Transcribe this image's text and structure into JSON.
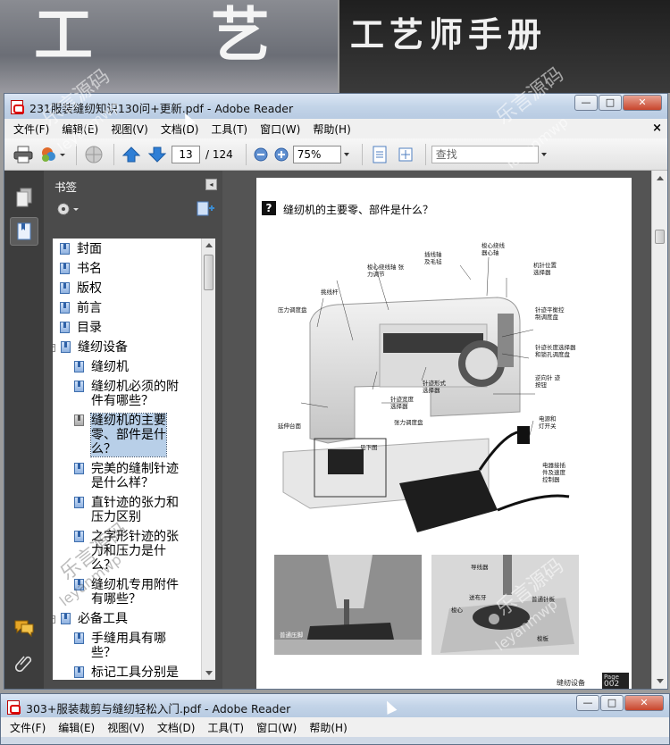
{
  "background": {
    "left_cover_chars": [
      "工",
      "艺"
    ],
    "right_cover_title": "工艺师手册"
  },
  "window1": {
    "title": "231服装缝纫知识130问+更新.pdf - Adobe Reader",
    "menus": [
      "文件(F)",
      "编辑(E)",
      "视图(V)",
      "文档(D)",
      "工具(T)",
      "窗口(W)",
      "帮助(H)"
    ],
    "toolbar": {
      "page_current": "13",
      "page_total": "/ 124",
      "zoom": "75%",
      "find_placeholder": "查找"
    },
    "bookmarks_title": "书签",
    "bookmarks": [
      {
        "label": "封面",
        "level": 0,
        "icon": "bookmark-icon"
      },
      {
        "label": "书名",
        "level": 0,
        "icon": "bookmark-icon"
      },
      {
        "label": "版权",
        "level": 0,
        "icon": "bookmark-icon"
      },
      {
        "label": "前言",
        "level": 0,
        "icon": "bookmark-icon"
      },
      {
        "label": "目录",
        "level": 0,
        "icon": "bookmark-icon"
      },
      {
        "label": "缝纫设备",
        "level": 0,
        "icon": "bookmark-icon",
        "expander": "−"
      },
      {
        "label": "缝纫机",
        "level": 1,
        "icon": "bookmark-icon"
      },
      {
        "label": "缝纫机必须的附件有哪些？",
        "level": 1,
        "icon": "bookmark-icon",
        "lines": [
          "缝纫机必须的附",
          "件有哪些？"
        ]
      },
      {
        "label": "缝纫机的主要零、部件是什么？",
        "level": 1,
        "icon": "bookmark-icon",
        "selected": true,
        "lines": [
          "缝纫机的主要",
          "零、部件是什",
          "么？"
        ]
      },
      {
        "label": "完美的缝制针迹是什么样？",
        "level": 1,
        "icon": "bookmark-icon",
        "lines": [
          "完美的缝制针迹",
          "是什么样？"
        ]
      },
      {
        "label": "直针迹的张力和压力区别",
        "level": 1,
        "icon": "bookmark-icon",
        "lines": [
          "直针迹的张力和",
          "压力区别"
        ]
      },
      {
        "label": "之字形针迹的张力和压力是什么？",
        "level": 1,
        "icon": "bookmark-icon",
        "lines": [
          "之字形针迹的张",
          "力和压力是什",
          "么？"
        ]
      },
      {
        "label": "缝纫机专用附件有哪些？",
        "level": 1,
        "icon": "bookmark-icon",
        "lines": [
          "缝纫机专用附件",
          "有哪些？"
        ]
      },
      {
        "label": "必备工具",
        "level": 0,
        "icon": "bookmark-icon",
        "expander": "−"
      },
      {
        "label": "手缝用具有哪些？",
        "level": 1,
        "icon": "bookmark-icon",
        "lines": [
          "手缝用具有哪",
          "些？"
        ]
      },
      {
        "label": "标记工具分别是",
        "level": 1,
        "icon": "bookmark-icon"
      }
    ],
    "page": {
      "question_mark": "?",
      "title": "缝纫机的主要零、部件是什么？",
      "callouts": {
        "c1": "梭心绕线轴 张力调节",
        "c2": "插线轴 及毛毡",
        "c3": "梭心绕线 器心轴",
        "c4": "机针位置 选择器",
        "c5": "挑线杆",
        "c6": "压力调度盘",
        "c7": "针迹平衡控 制调度盘",
        "c8": "针迹长度选择器 和锁孔调度盘",
        "c9": "针迹形式 选择器",
        "c10": "针迹宽度 选择器",
        "c11": "逆向针 迹按钮",
        "c12": "张力调度盘",
        "c13": "电源和 灯开关",
        "c14": "延伸台面",
        "c15": "见下图",
        "c16": "电器接插 件及速度 控制器",
        "c17": "普通压脚",
        "c18": "导线器",
        "c19": "送布牙",
        "c20": "普通针板",
        "c21": "梭心",
        "c22": "梭板"
      },
      "footer_section": "缝纫设备",
      "footer_page_label": "Page",
      "footer_page_num": "002"
    }
  },
  "window2": {
    "title": "303+服装裁剪与缝纫轻松入门.pdf - Adobe Reader",
    "menus": [
      "文件(F)",
      "编辑(E)",
      "视图(V)",
      "文档(D)",
      "工具(T)",
      "窗口(W)",
      "帮助(H)"
    ]
  },
  "watermarks": [
    "乐言源码",
    "leyanmwp"
  ]
}
